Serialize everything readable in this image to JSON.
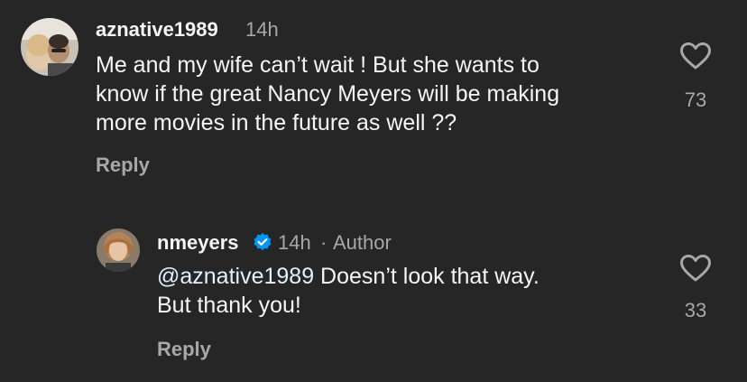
{
  "comment": {
    "username": "aznative1989",
    "time": "14h",
    "text_lines": [
      "Me and my wife can’t wait ! But she wants to",
      "know if the great Nancy Meyers will be making",
      "more movies in the future as well ??"
    ],
    "reply_label": "Reply",
    "like_count": "73",
    "like_icon": "heart-outline-icon"
  },
  "reply": {
    "username": "nmeyers",
    "verified_icon": "verified-badge-icon",
    "time": "14h",
    "separator": "·",
    "author_label": "Author",
    "mention": "@aznative1989",
    "text_line1_rest": " Doesn’t look that way.",
    "text_line2": "But thank you!",
    "reply_label": "Reply",
    "like_count": "33",
    "like_icon": "heart-outline-icon"
  },
  "colors": {
    "background": "#262626",
    "primary_text": "#f5f5f5",
    "secondary_text": "#a8a8a8",
    "mention": "#e0f1ff",
    "verified": "#0095f6"
  }
}
